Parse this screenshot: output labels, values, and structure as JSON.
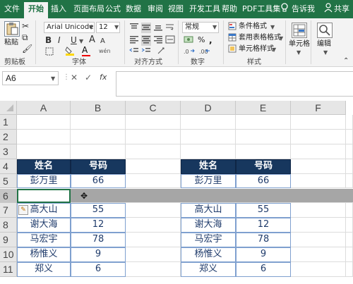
{
  "ribbon_tabs": [
    "文件",
    "开始",
    "插入",
    "页面布局",
    "公式",
    "数据",
    "审阅",
    "视图",
    "开发工具",
    "帮助",
    "PDF工具集"
  ],
  "tell_me": "告诉我",
  "share": "共享",
  "clipboard": {
    "paste_label": "粘贴",
    "group_label": "剪贴板"
  },
  "font": {
    "name": "Arial Unicode",
    "size": "12",
    "bold": "B",
    "italic": "I",
    "underline": "U",
    "grow": "A",
    "shrink": "A",
    "font_color_glyph": "A",
    "phonetic": "wén",
    "group_label": "字体"
  },
  "alignment": {
    "group_label": "对齐方式"
  },
  "number": {
    "format": "常规",
    "currency": "",
    "percent": "%",
    "comma": ",",
    "group_label": "数字"
  },
  "styles": {
    "conditional": "条件格式",
    "table": "套用表格格式",
    "cell_styles": "单元格样式",
    "group_label": "样式"
  },
  "cells_group": {
    "label": "单元格"
  },
  "editing_group": {
    "label": "编辑"
  },
  "formula_bar": {
    "name_box": "A6",
    "cancel": "✕",
    "enter": "✓",
    "fx": "fx",
    "content": ""
  },
  "columns": [
    "A",
    "B",
    "C",
    "D",
    "E",
    "F"
  ],
  "rows": [
    "1",
    "2",
    "3",
    "4",
    "5",
    "6",
    "7",
    "8",
    "9",
    "10",
    "11"
  ],
  "left_table": {
    "header": [
      "姓名",
      "号码"
    ],
    "rows": [
      [
        "彭万里",
        "66"
      ],
      [
        "高大山",
        "55"
      ],
      [
        "谢大海",
        "12"
      ],
      [
        "马宏宇",
        "78"
      ],
      [
        "杨惟义",
        "9"
      ],
      [
        "郑义",
        "6"
      ]
    ]
  },
  "right_table": {
    "header": [
      "姓名",
      "号码"
    ],
    "rows": [
      [
        "彭万里",
        "66"
      ],
      [
        "高大山",
        "55"
      ],
      [
        "谢大海",
        "12"
      ],
      [
        "马宏宇",
        "78"
      ],
      [
        "杨惟义",
        "9"
      ],
      [
        "郑义",
        "6"
      ]
    ]
  },
  "selected_cell": "A6",
  "colors": {
    "accent": "#217346",
    "header_fill": "#17375e",
    "selection": "#a6a6a6"
  }
}
